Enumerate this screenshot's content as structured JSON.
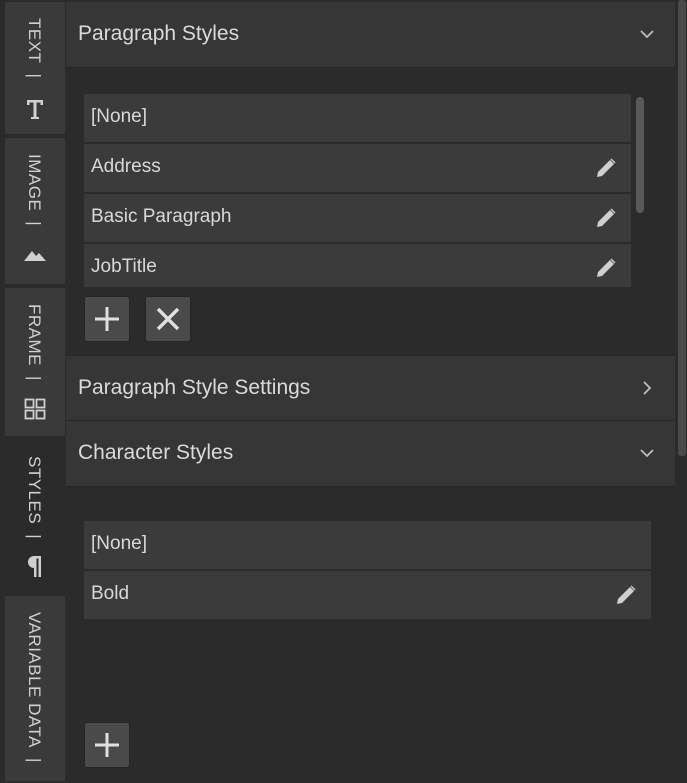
{
  "rail": {
    "tabs": [
      {
        "label": "TEXT",
        "icon": "text-t-icon",
        "active": false
      },
      {
        "label": "IMAGE",
        "icon": "mountain-icon",
        "active": false
      },
      {
        "label": "FRAME",
        "icon": "grid-icon",
        "active": false
      },
      {
        "label": "STYLES",
        "icon": "pilcrow-icon",
        "active": true
      },
      {
        "label": "VARIABLE DATA",
        "icon": "",
        "active": false
      }
    ]
  },
  "paragraph_styles": {
    "title": "Paragraph Styles",
    "items": [
      {
        "label": "[None]",
        "editable": false
      },
      {
        "label": "Address",
        "editable": true
      },
      {
        "label": "Basic Paragraph",
        "editable": true
      },
      {
        "label": "JobTitle",
        "editable": true
      }
    ],
    "add_icon": "plus-icon",
    "delete_icon": "x-icon"
  },
  "paragraph_style_settings": {
    "title": "Paragraph Style Settings"
  },
  "character_styles": {
    "title": "Character Styles",
    "items": [
      {
        "label": "[None]",
        "editable": false
      },
      {
        "label": "Bold",
        "editable": true
      }
    ],
    "add_icon": "plus-icon"
  },
  "colors": {
    "background": "#2b2b2b",
    "header": "#363636",
    "row": "#3b3b3b",
    "button": "#4a4a4a",
    "text": "#d8d8d8"
  }
}
